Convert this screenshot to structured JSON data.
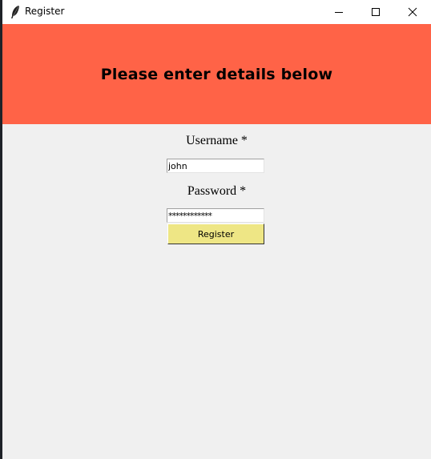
{
  "window": {
    "title": "Register",
    "controls": {
      "minimize_icon": "minimize-icon",
      "maximize_icon": "maximize-icon",
      "close_icon": "close-icon"
    }
  },
  "header": {
    "text": "Please enter details below",
    "background_color": "#ff6347"
  },
  "form": {
    "username_label": "Username *",
    "username_value": "john",
    "password_label": "Password *",
    "password_value": "************",
    "register_label": "Register",
    "register_color": "#eee685"
  }
}
